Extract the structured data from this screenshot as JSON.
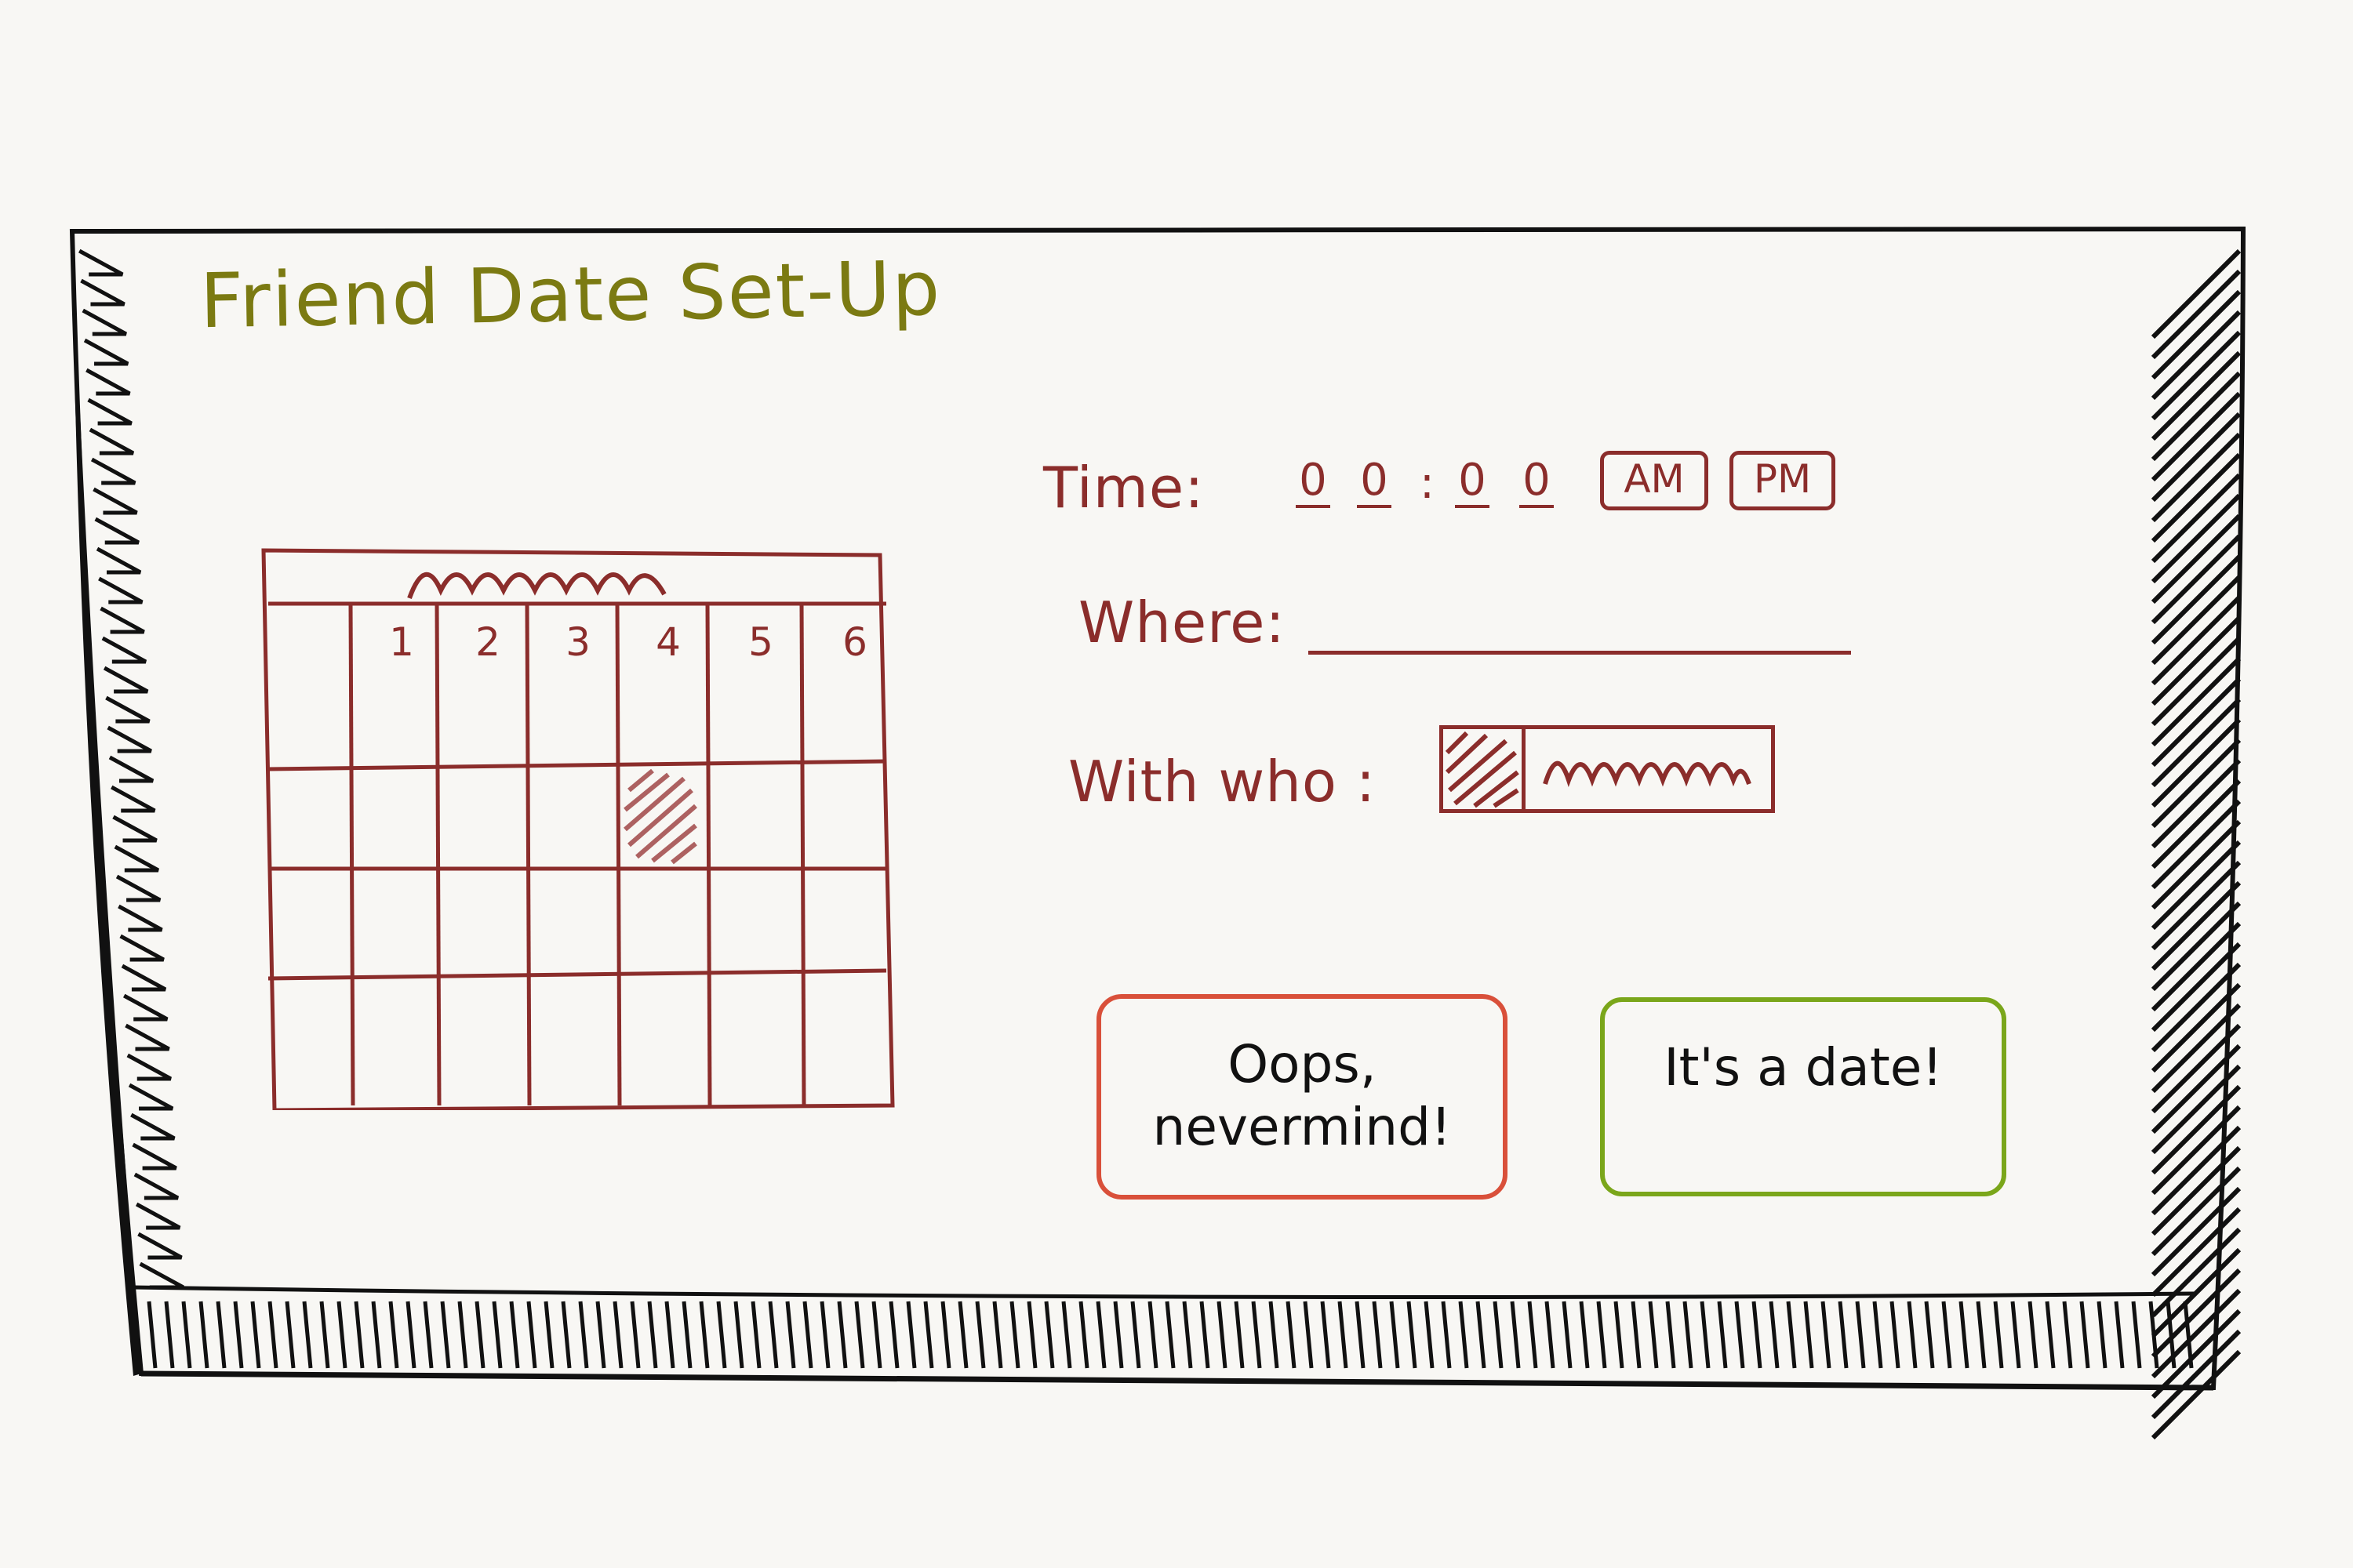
{
  "window": {
    "title": "Friend Date Set-Up"
  },
  "calendar": {
    "month_label_icon": "scribble-icon",
    "day_headers": [
      "1",
      "2",
      "3",
      "4",
      "5",
      "6"
    ],
    "selected_day": "4"
  },
  "form": {
    "time": {
      "label": "Time:",
      "hour_digits": [
        "0",
        "0"
      ],
      "separator": ":",
      "minute_digits": [
        "0",
        "0"
      ],
      "am_label": "AM",
      "pm_label": "PM"
    },
    "where": {
      "label": "Where:",
      "value": ""
    },
    "with_who": {
      "label": "With who :",
      "avatar_icon": "hatched-avatar-icon",
      "name_icon": "scribble-icon"
    }
  },
  "actions": {
    "cancel_label": "Oops, nevermind!",
    "confirm_label": "It's a date!"
  },
  "colors": {
    "title": "#7b7a12",
    "form": "#8b2d2b",
    "cancel_border": "#d9503a",
    "confirm_border": "#7aa61a",
    "frame": "#111111"
  }
}
